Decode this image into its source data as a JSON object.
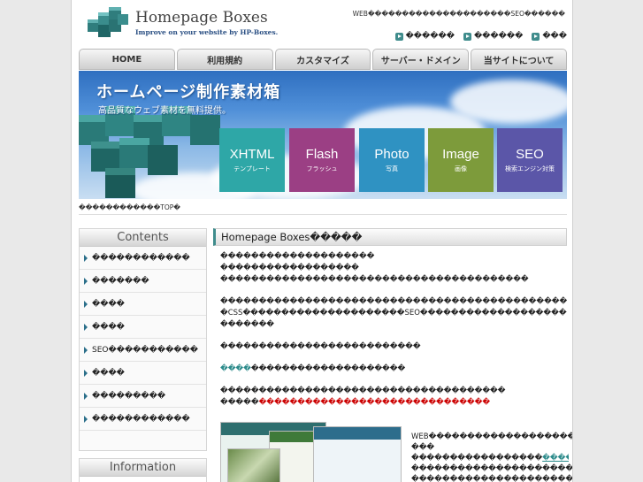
{
  "header": {
    "logo_title": "Homepage Boxes",
    "logo_tagline": "Improve on your website by HP-Boxes.",
    "description": "WEB���������������������SEO������",
    "links": [
      {
        "label": "������"
      },
      {
        "label": "������"
      },
      {
        "label": "���"
      }
    ]
  },
  "nav": {
    "tabs": [
      {
        "label": "HOME"
      },
      {
        "label": "利用規約"
      },
      {
        "label": "カスタマイズ"
      },
      {
        "label": "サーバー・ドメイン"
      },
      {
        "label": "当サイトについて"
      }
    ]
  },
  "banner": {
    "title": "ホームページ制作素材箱",
    "subtitle": "高品質なウェブ素材を無料提供。",
    "tiles": [
      {
        "title": "XHTML",
        "sub": "テンプレート",
        "color": "#2ea7a7"
      },
      {
        "title": "Flash",
        "sub": "フラッシュ",
        "color": "#9b3f84"
      },
      {
        "title": "Photo",
        "sub": "写真",
        "color": "#2f92c2"
      },
      {
        "title": "Image",
        "sub": "画像",
        "color": "#7d9b3b"
      },
      {
        "title": "SEO",
        "sub": "検索エンジン対策",
        "color": "#5b56a8"
      }
    ]
  },
  "breadcrumb": "������������TOP�",
  "sidebar": {
    "contents_heading": "Contents",
    "items": [
      {
        "label": "������������"
      },
      {
        "label": "�������"
      },
      {
        "label": "����"
      },
      {
        "label": "����"
      },
      {
        "label": "SEO�����������"
      },
      {
        "label": "����"
      },
      {
        "label": "���������"
      },
      {
        "label": "������������"
      }
    ],
    "information_heading": "Information"
  },
  "main": {
    "heading": "Homepage Boxes�����",
    "para1": [
      "��������������������",
      "������������������",
      "����������������������������������������"
    ],
    "para2": [
      "�����������������������������������������������������XHTML",
      "�CSS���������������������SEO����������������������������������",
      "�������"
    ],
    "para3": "��������������������������",
    "para4_link": "����",
    "para4_rest": "��������������������",
    "para5_line1": "�������������������������������������",
    "para5_lead": "�����",
    "para5_red": "������������������������������",
    "aside": [
      "WEB������������������������������",
      "���",
      "�����������������",
      "������",
      "��������������������������������",
      "����������������������������"
    ],
    "aside_link": "��������"
  },
  "colors": {
    "accent_teal": "#3f8c8c",
    "link_red": "#cc0000"
  }
}
